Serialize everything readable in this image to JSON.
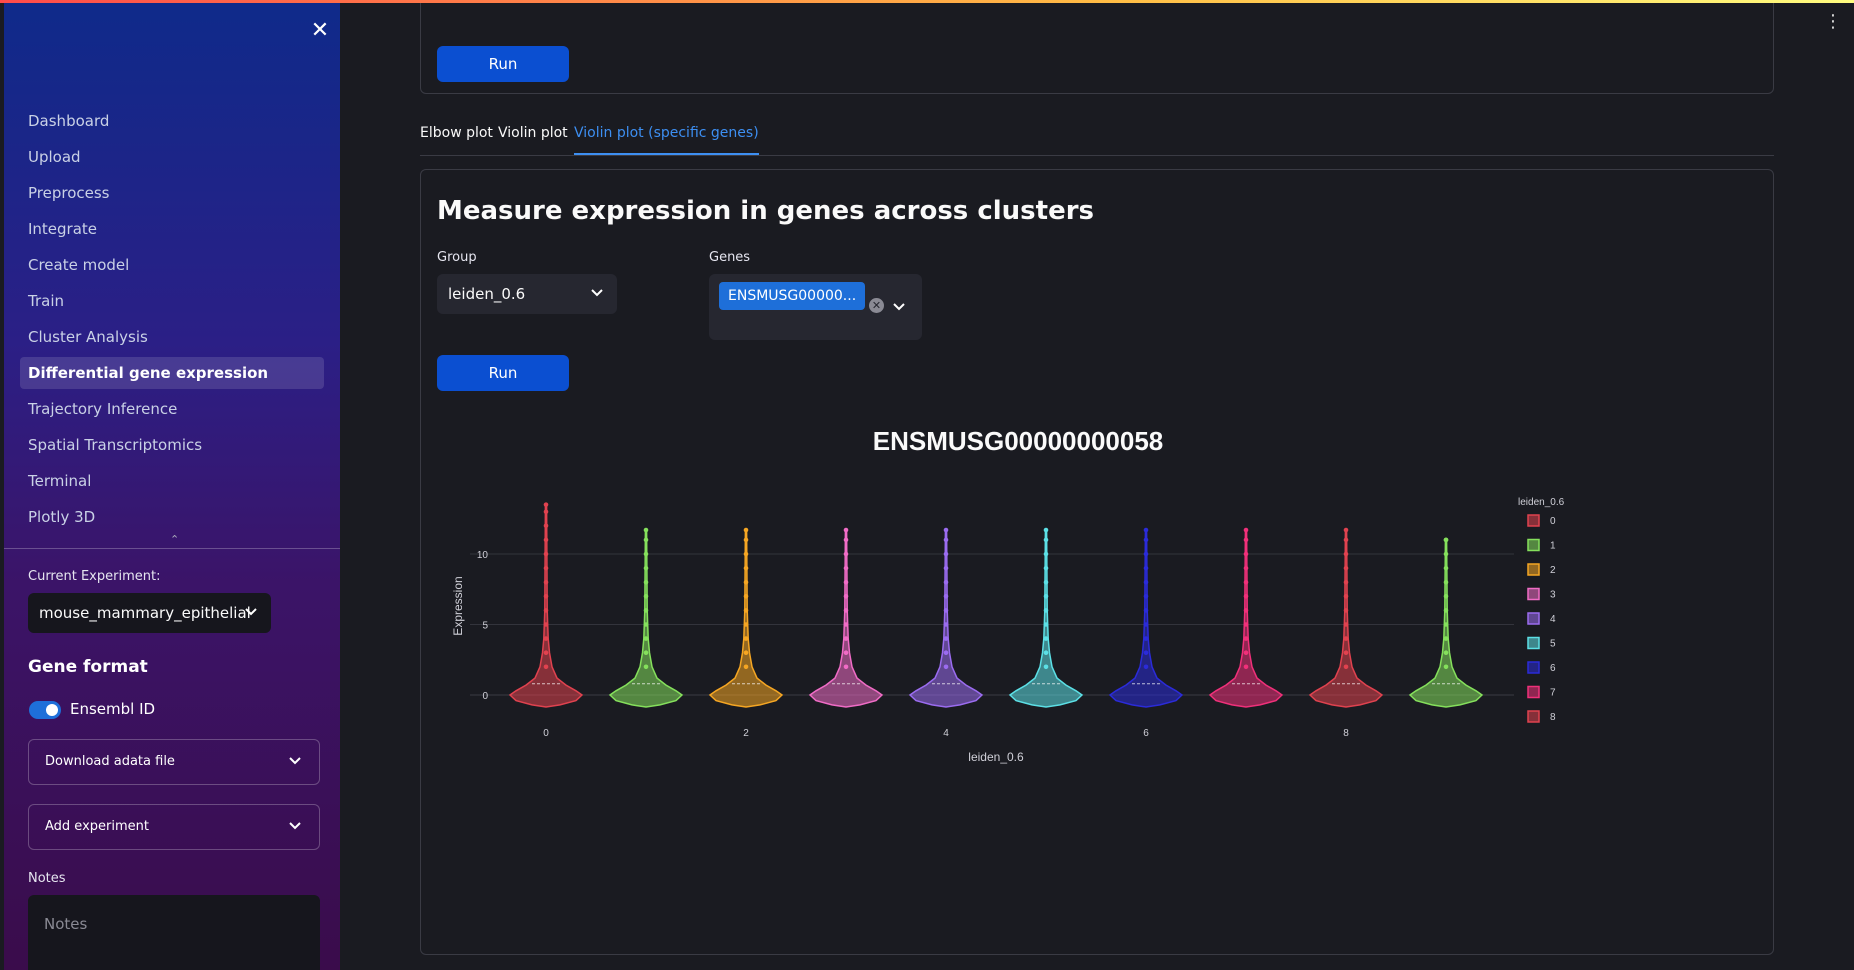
{
  "sidebar": {
    "nav": [
      {
        "label": "Dashboard",
        "active": false
      },
      {
        "label": "Upload",
        "active": false
      },
      {
        "label": "Preprocess",
        "active": false
      },
      {
        "label": "Integrate",
        "active": false
      },
      {
        "label": "Create model",
        "active": false
      },
      {
        "label": "Train",
        "active": false
      },
      {
        "label": "Cluster Analysis",
        "active": false
      },
      {
        "label": "Differential gene expression",
        "active": true
      },
      {
        "label": "Trajectory Inference",
        "active": false
      },
      {
        "label": "Spatial Transcriptomics",
        "active": false
      },
      {
        "label": "Terminal",
        "active": false
      },
      {
        "label": "Plotly 3D",
        "active": false
      }
    ],
    "current_experiment_label": "Current Experiment:",
    "current_experiment_value": "mouse_mammary_epithelial",
    "gene_format_title": "Gene format",
    "toggle_label": "Ensembl ID",
    "toggle_on": true,
    "download_label": "Download adata file",
    "add_experiment_label": "Add experiment",
    "notes_label": "Notes",
    "notes_placeholder": "Notes"
  },
  "main": {
    "top_run_label": "Run",
    "tabs": [
      {
        "label": "Elbow plot",
        "active": false
      },
      {
        "label": "Violin plot",
        "active": false
      },
      {
        "label": "Violin plot (specific genes)",
        "active": true
      }
    ],
    "card_title": "Measure expression in genes across clusters",
    "group_label": "Group",
    "group_value": "leiden_0.6",
    "genes_label": "Genes",
    "genes_chip": "ENSMUSG00000...",
    "run_label": "Run"
  },
  "chart_data": {
    "type": "violin",
    "title": "ENSMUSG00000000058",
    "xlabel": "leiden_0.6",
    "ylabel": "Expression",
    "ylim": [
      -1,
      14
    ],
    "yticks": [
      0,
      5,
      10
    ],
    "xtick_labels": [
      "0",
      "2",
      "4",
      "6",
      "8"
    ],
    "legend_title": "leiden_0.6",
    "legend_position": "right",
    "categories": [
      "0",
      "1",
      "2",
      "3",
      "4",
      "5",
      "6",
      "7",
      "8",
      "9"
    ],
    "colors": [
      "#e0424f",
      "#85e05c",
      "#f5a623",
      "#f06cc6",
      "#9b6cf0",
      "#5ce0e6",
      "#2b2bd9",
      "#f0307a",
      "#e0424f",
      "#85e05c"
    ],
    "max_values": [
      13.5,
      11.7,
      11.7,
      11.7,
      11.7,
      11.7,
      11.7,
      11.7,
      11.7,
      11.0
    ],
    "median": 0.8,
    "legend_entries": [
      "0",
      "1",
      "2",
      "3",
      "4",
      "5",
      "6",
      "7",
      "8"
    ]
  }
}
